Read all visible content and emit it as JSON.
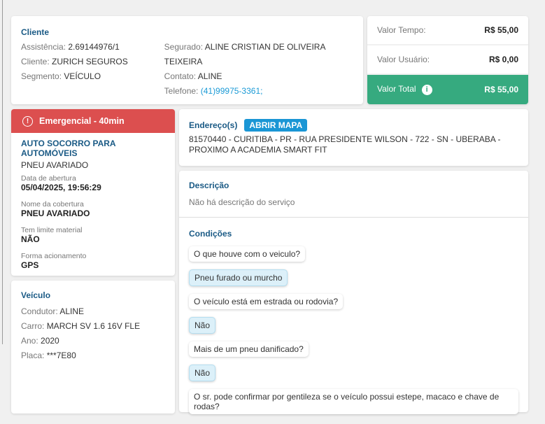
{
  "cliente": {
    "title": "Cliente",
    "assistencia_lbl": "Assistência:",
    "assistencia": "2.69144976/1",
    "cliente_lbl": "Cliente:",
    "cliente": "ZURICH SEGUROS",
    "segmento_lbl": "Segmento:",
    "segmento": "VEÍCULO",
    "segurado_lbl": "Segurado:",
    "segurado": "ALINE CRISTIAN DE OLIVEIRA TEIXEIRA",
    "contato_lbl": "Contato:",
    "contato": "ALINE",
    "telefone_lbl": "Telefone:",
    "telefone": "(41)99975-3361;"
  },
  "valores": {
    "tempo_lbl": "Valor Tempo:",
    "tempo": "R$ 55,00",
    "usuario_lbl": "Valor Usuário:",
    "usuario": "R$ 0,00",
    "total_lbl": "Valor Total",
    "total": "R$ 55,00",
    "accent": "#36aa7f"
  },
  "servico": {
    "badge": "Emergencial - 40min",
    "badge_color": "#dc4f4f",
    "tipo": "AUTO SOCORRO PARA AUTOMÓVEIS",
    "subtipo": "PNEU AVARIADO",
    "data_lbl": "Data de abertura",
    "data": "05/04/2025, 19:56:29",
    "cobertura_lbl": "Nome da cobertura",
    "cobertura": "PNEU AVARIADO",
    "limite_lbl": "Tem limite material",
    "limite": "NÃO",
    "forma_lbl": "Forma acionamento",
    "forma": "GPS"
  },
  "veiculo": {
    "title": "Veículo",
    "condutor_lbl": "Condutor:",
    "condutor": "ALINE",
    "carro_lbl": "Carro:",
    "carro": "MARCH SV 1.6 16V FLE",
    "ano_lbl": "Ano:",
    "ano": "2020",
    "placa_lbl": "Placa:",
    "placa": "***7E80"
  },
  "endereco": {
    "title": "Endereço(s)",
    "button": "ABRIR MAPA",
    "text": "81570440 - CURITIBA - PR - RUA PRESIDENTE WILSON - 722 - SN - UBERABA - PROXIMO A ACADEMIA SMART FIT"
  },
  "descricao": {
    "title": "Descrição",
    "text": "Não há descrição do serviço"
  },
  "condicoes": {
    "title": "Condições",
    "items": [
      {
        "text": "O que houve com o veiculo?",
        "answer": false
      },
      {
        "text": "Pneu furado ou murcho",
        "answer": true
      },
      {
        "text": "O veículo está em estrada ou rodovia?",
        "answer": false
      },
      {
        "text": "Não",
        "answer": true
      },
      {
        "text": "Mais de um pneu danificado?",
        "answer": false
      },
      {
        "text": "Não",
        "answer": true
      },
      {
        "text": "O sr. pode confirmar por gentileza se o veículo possui estepe, macaco e chave de rodas?",
        "answer": false
      }
    ]
  }
}
